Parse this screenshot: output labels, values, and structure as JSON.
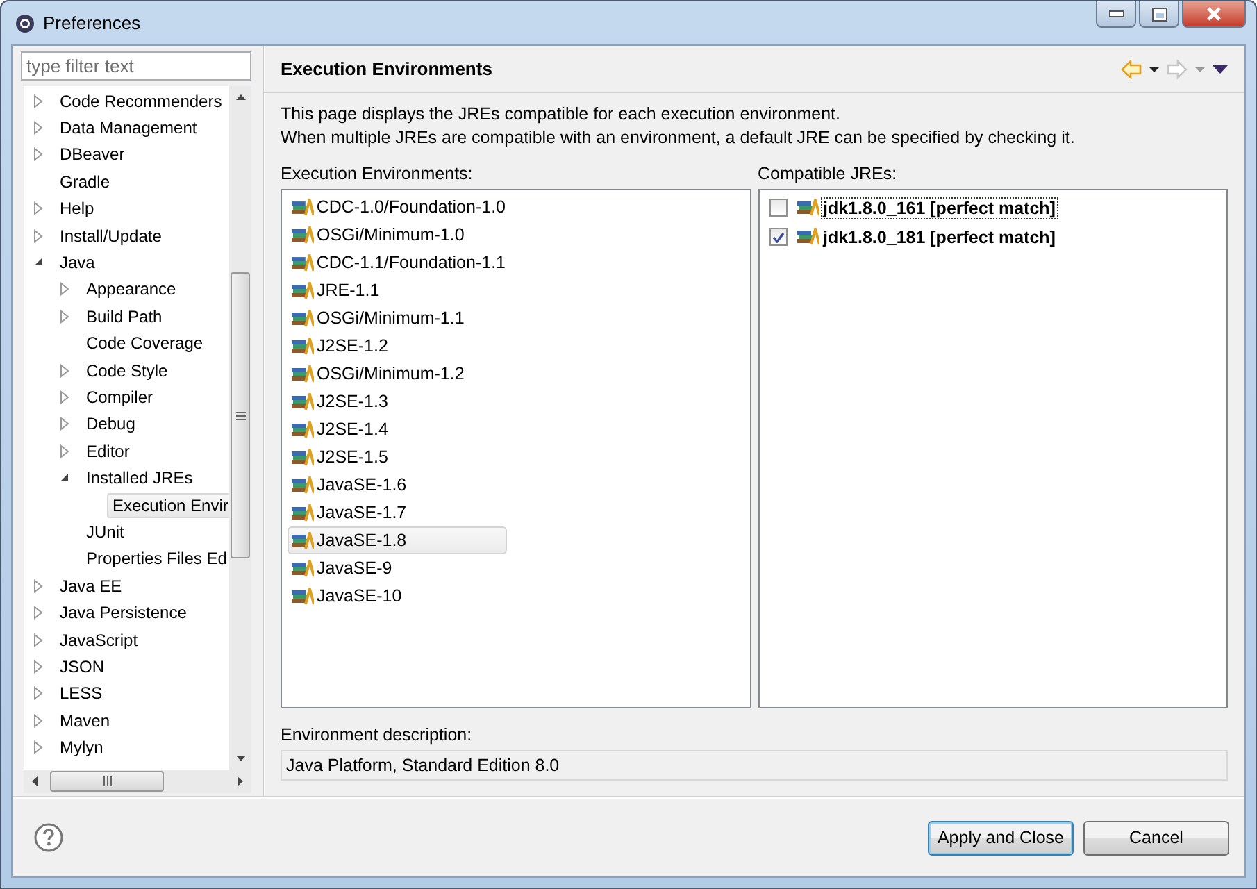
{
  "window": {
    "title": "Preferences"
  },
  "filter": {
    "placeholder": "type filter text"
  },
  "tree": [
    {
      "label": "Code Recommenders",
      "kind": "branch",
      "expanded": false,
      "selected": false
    },
    {
      "label": "Data Management",
      "kind": "branch",
      "expanded": false,
      "selected": false
    },
    {
      "label": "DBeaver",
      "kind": "branch",
      "expanded": false,
      "selected": false
    },
    {
      "label": "Gradle",
      "kind": "leaf",
      "selected": false
    },
    {
      "label": "Help",
      "kind": "branch",
      "expanded": false,
      "selected": false
    },
    {
      "label": "Install/Update",
      "kind": "branch",
      "expanded": false,
      "selected": false
    },
    {
      "label": "Java",
      "kind": "branch",
      "expanded": true,
      "selected": false,
      "children": [
        {
          "label": "Appearance",
          "kind": "branch",
          "expanded": false,
          "selected": false
        },
        {
          "label": "Build Path",
          "kind": "branch",
          "expanded": false,
          "selected": false
        },
        {
          "label": "Code Coverage",
          "kind": "leaf",
          "selected": false
        },
        {
          "label": "Code Style",
          "kind": "branch",
          "expanded": false,
          "selected": false
        },
        {
          "label": "Compiler",
          "kind": "branch",
          "expanded": false,
          "selected": false
        },
        {
          "label": "Debug",
          "kind": "branch",
          "expanded": false,
          "selected": false
        },
        {
          "label": "Editor",
          "kind": "branch",
          "expanded": false,
          "selected": false
        },
        {
          "label": "Installed JREs",
          "kind": "branch",
          "expanded": true,
          "selected": false,
          "children": [
            {
              "label": "Execution Envir",
              "kind": "leaf",
              "selected": true
            }
          ]
        },
        {
          "label": "JUnit",
          "kind": "leaf",
          "selected": false
        },
        {
          "label": "Properties Files Ed",
          "kind": "leaf",
          "selected": false
        }
      ]
    },
    {
      "label": "Java EE",
      "kind": "branch",
      "expanded": false,
      "selected": false
    },
    {
      "label": "Java Persistence",
      "kind": "branch",
      "expanded": false,
      "selected": false
    },
    {
      "label": "JavaScript",
      "kind": "branch",
      "expanded": false,
      "selected": false
    },
    {
      "label": "JSON",
      "kind": "branch",
      "expanded": false,
      "selected": false
    },
    {
      "label": "LESS",
      "kind": "branch",
      "expanded": false,
      "selected": false
    },
    {
      "label": "Maven",
      "kind": "branch",
      "expanded": false,
      "selected": false
    },
    {
      "label": "Mylyn",
      "kind": "branch",
      "expanded": false,
      "selected": false
    }
  ],
  "page": {
    "title": "Execution Environments",
    "nav": {
      "back_enabled": true,
      "forward_enabled": false
    },
    "description": [
      "This page displays the JREs compatible for each execution environment.",
      "When multiple JREs are compatible with an environment, a default JRE can be specified by checking it."
    ],
    "environments": {
      "label": "Execution Environments:",
      "items": [
        {
          "name": "CDC-1.0/Foundation-1.0",
          "selected": false
        },
        {
          "name": "OSGi/Minimum-1.0",
          "selected": false
        },
        {
          "name": "CDC-1.1/Foundation-1.1",
          "selected": false
        },
        {
          "name": "JRE-1.1",
          "selected": false
        },
        {
          "name": "OSGi/Minimum-1.1",
          "selected": false
        },
        {
          "name": "J2SE-1.2",
          "selected": false
        },
        {
          "name": "OSGi/Minimum-1.2",
          "selected": false
        },
        {
          "name": "J2SE-1.3",
          "selected": false
        },
        {
          "name": "J2SE-1.4",
          "selected": false
        },
        {
          "name": "J2SE-1.5",
          "selected": false
        },
        {
          "name": "JavaSE-1.6",
          "selected": false
        },
        {
          "name": "JavaSE-1.7",
          "selected": false
        },
        {
          "name": "JavaSE-1.8",
          "selected": true
        },
        {
          "name": "JavaSE-9",
          "selected": false
        },
        {
          "name": "JavaSE-10",
          "selected": false
        }
      ]
    },
    "jres": {
      "label": "Compatible JREs:",
      "items": [
        {
          "name": "jdk1.8.0_161 [perfect match]",
          "checked": false,
          "focused": true
        },
        {
          "name": "jdk1.8.0_181 [perfect match]",
          "checked": true,
          "focused": false
        }
      ]
    },
    "environment_description": {
      "label": "Environment description:",
      "value": "Java Platform, Standard Edition 8.0"
    }
  },
  "buttons": [
    {
      "label": "Apply and Close",
      "default": true
    },
    {
      "label": "Cancel",
      "default": false
    }
  ]
}
